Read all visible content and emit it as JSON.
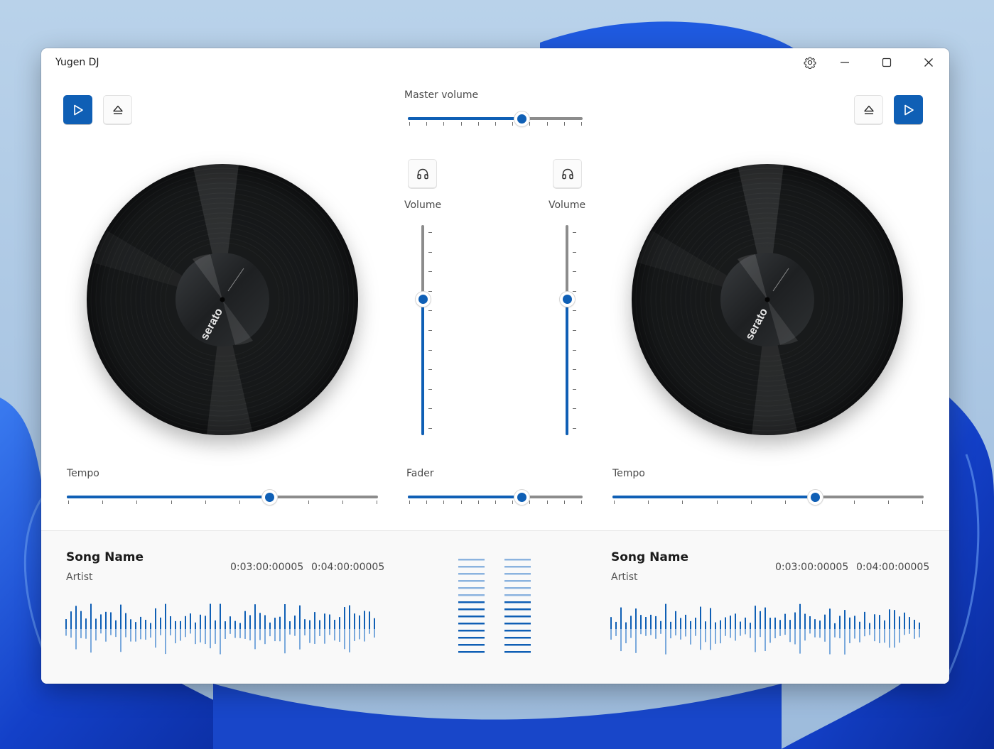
{
  "window": {
    "title": "Yugen DJ"
  },
  "titlebar": {
    "settings_icon": "gear-icon",
    "minimize_icon": "minimize-icon",
    "maximize_icon": "maximize-icon",
    "close_icon": "close-icon"
  },
  "colors": {
    "accent": "#0f5fb5",
    "rail": "#8c8c8c",
    "panel": "#f9f9f9"
  },
  "master_volume": {
    "label": "Master volume",
    "value": 0.65
  },
  "left_deck": {
    "play_icon": "play-icon",
    "eject_icon": "eject-icon",
    "volume_label": "Volume",
    "volume_value": 0.65,
    "tempo_label": "Tempo",
    "tempo_value": 0.65,
    "song_name": "Song Name",
    "artist": "Artist",
    "time_elapsed": "0:03:00:00005",
    "time_total": "0:04:00:00005"
  },
  "right_deck": {
    "play_icon": "play-icon",
    "eject_icon": "eject-icon",
    "volume_label": "Volume",
    "volume_value": 0.65,
    "tempo_label": "Tempo",
    "tempo_value": 0.65,
    "song_name": "Song Name",
    "artist": "Artist",
    "time_elapsed": "0:03:00:00005",
    "time_total": "0:04:00:00005"
  },
  "fader": {
    "label": "Fader",
    "value": 0.65
  },
  "level_meters": {
    "left_level": 0.6,
    "right_level": 0.6
  }
}
